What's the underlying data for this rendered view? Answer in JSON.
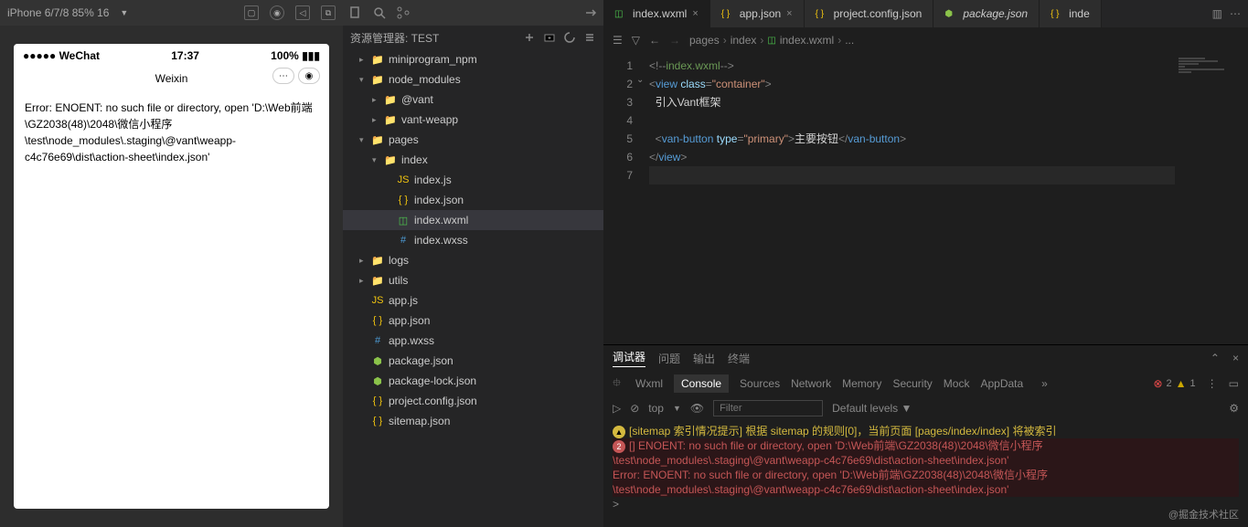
{
  "simulator": {
    "device": "iPhone 6/7/8 85% 16",
    "status_left": "●●●●● WeChat",
    "status_time": "17:37",
    "status_right": "100%",
    "status_batt": "▮▮▮",
    "title": "Weixin",
    "error": "Error: ENOENT: no such file or directory, open 'D:\\Web前端\\GZ2038(48)\\2048\\微信小程序\\test\\node_modules\\.staging\\@vant\\weapp-c4c76e69\\dist\\action-sheet\\index.json'"
  },
  "explorer": {
    "title": "资源管理器: TEST",
    "tree": [
      {
        "d": 1,
        "chev": "▸",
        "ico": "folder",
        "label": "miniprogram_npm"
      },
      {
        "d": 1,
        "chev": "▾",
        "ico": "folder g",
        "label": "node_modules"
      },
      {
        "d": 2,
        "chev": "▸",
        "ico": "folder",
        "label": "@vant"
      },
      {
        "d": 2,
        "chev": "▸",
        "ico": "folder",
        "label": "vant-weapp"
      },
      {
        "d": 1,
        "chev": "▾",
        "ico": "folder g",
        "label": "pages"
      },
      {
        "d": 2,
        "chev": "▾",
        "ico": "folder g",
        "label": "index"
      },
      {
        "d": 3,
        "chev": "",
        "ico": "js",
        "label": "index.js"
      },
      {
        "d": 3,
        "chev": "",
        "ico": "json-i",
        "label": "index.json"
      },
      {
        "d": 3,
        "chev": "",
        "ico": "wxml-i",
        "label": "index.wxml",
        "sel": true
      },
      {
        "d": 3,
        "chev": "",
        "ico": "wxss-i",
        "label": "index.wxss"
      },
      {
        "d": 1,
        "chev": "▸",
        "ico": "folder g",
        "label": "logs"
      },
      {
        "d": 1,
        "chev": "▸",
        "ico": "folder g",
        "label": "utils"
      },
      {
        "d": 1,
        "chev": "",
        "ico": "js",
        "label": "app.js"
      },
      {
        "d": 1,
        "chev": "",
        "ico": "json-i",
        "label": "app.json"
      },
      {
        "d": 1,
        "chev": "",
        "ico": "wxss-i",
        "label": "app.wxss"
      },
      {
        "d": 1,
        "chev": "",
        "ico": "pkg-i",
        "label": "package.json"
      },
      {
        "d": 1,
        "chev": "",
        "ico": "pkg-i",
        "label": "package-lock.json"
      },
      {
        "d": 1,
        "chev": "",
        "ico": "json-i",
        "label": "project.config.json"
      },
      {
        "d": 1,
        "chev": "",
        "ico": "json-i",
        "label": "sitemap.json"
      }
    ]
  },
  "tabs": [
    {
      "ico": "wxml-i",
      "label": "index.wxml",
      "active": true,
      "close": "×"
    },
    {
      "ico": "json-i",
      "label": "app.json",
      "close": "×"
    },
    {
      "ico": "json-i",
      "label": "project.config.json"
    },
    {
      "ico": "pkg-i",
      "label": "package.json",
      "italic": true
    },
    {
      "ico": "json-i",
      "label": "inde"
    }
  ],
  "breadcrumb": [
    "pages",
    "index",
    "index.wxml",
    "..."
  ],
  "code": {
    "lines": [
      {
        "n": "1",
        "html": "<span class='c-brk'>&lt;!--</span><span class='c-com'>index.wxml</span><span class='c-brk'>--&gt;</span>"
      },
      {
        "n": "2",
        "html": "<span class='c-brk'>&lt;</span><span class='c-tag'>view</span> <span class='c-attr'>class</span><span class='c-brk'>=</span><span class='c-str'>\"container\"</span><span class='c-brk'>&gt;</span>"
      },
      {
        "n": "3",
        "html": "  <span class='c-txt'>引入Vant框架</span>"
      },
      {
        "n": "4",
        "html": ""
      },
      {
        "n": "5",
        "html": "  <span class='c-brk'>&lt;</span><span class='c-tag'>van-button</span> <span class='c-attr'>type</span><span class='c-brk'>=</span><span class='c-str'>\"primary\"</span><span class='c-brk'>&gt;</span><span class='c-txt'>主要按钮</span><span class='c-brk'>&lt;/</span><span class='c-tag'>van-button</span><span class='c-brk'>&gt;</span>"
      },
      {
        "n": "6",
        "html": "<span class='c-brk'>&lt;/</span><span class='c-tag'>view</span><span class='c-brk'>&gt;</span>"
      },
      {
        "n": "7",
        "html": "",
        "cur": true
      }
    ]
  },
  "terminal": {
    "tabs": [
      "调试器",
      "问题",
      "输出",
      "终端"
    ],
    "subtabs": [
      "Wxml",
      "Console",
      "Sources",
      "Network",
      "Memory",
      "Security",
      "Mock",
      "AppData"
    ],
    "subactive": "Console",
    "errors": "2",
    "warnings": "1",
    "top": "top",
    "filter_ph": "Filter",
    "levels": "Default levels ▼",
    "lines": [
      {
        "t": "warn",
        "badge": "▲",
        "text": "[sitemap 索引情况提示] 根据 sitemap 的规则[0]，当前页面 [pages/index/index] 将被索引"
      },
      {
        "t": "err",
        "badge": "2",
        "text": "[] ENOENT: no such file or directory, open 'D:\\Web前端\\GZ2038(48)\\2048\\微信小程序\\test\\node_modules\\.staging\\@vant\\weapp-c4c76e69\\dist\\action-sheet\\index.json'"
      },
      {
        "t": "err",
        "text": "   Error: ENOENT: no such file or directory, open 'D:\\Web前端\\GZ2038(48)\\2048\\微信小程序\\test\\node_modules\\.staging\\@vant\\weapp-c4c76e69\\dist\\action-sheet\\index.json'"
      },
      {
        "t": "info",
        "text": ">"
      }
    ]
  },
  "copyright": "@掘金技术社区"
}
